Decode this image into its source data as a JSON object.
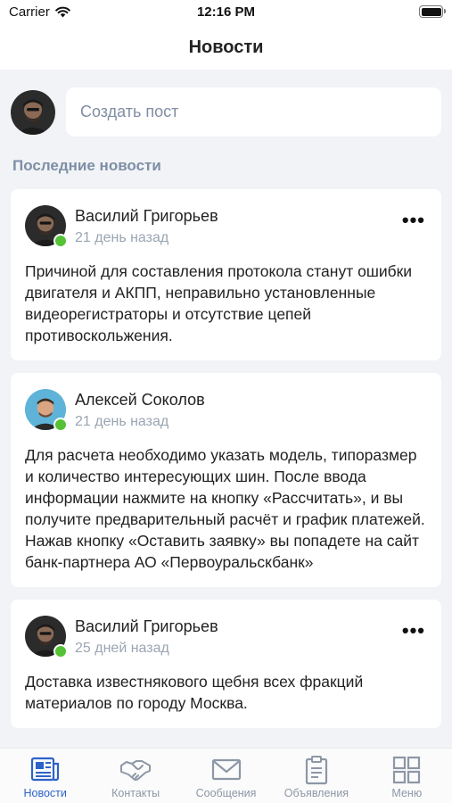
{
  "status_bar": {
    "carrier": "Carrier",
    "time": "12:16 PM"
  },
  "header": {
    "title": "Новости"
  },
  "composer": {
    "placeholder": "Создать пост"
  },
  "section": {
    "title": "Последние новости"
  },
  "posts": [
    {
      "author": "Василий Григорьев",
      "time": "21 день назад",
      "has_menu": true,
      "online": true,
      "text": "Причиной для составления протокола станут ошибки двигателя и АКПП, неправильно установленные видеорегистраторы и отсутствие цепей противоскольжения."
    },
    {
      "author": "Алексей Соколов",
      "time": "21 день назад",
      "has_menu": false,
      "online": true,
      "text": "Для расчета необходимо указать модель, типоразмер и количество интересующих шин. После ввода информации нажмите на кнопку «Рассчитать», и вы получите предварительный расчёт и график платежей. Нажав кнопку «Оставить заявку» вы попадете на сайт банк-партнера АО «Первоуральскбанк»"
    },
    {
      "author": "Василий Григорьев",
      "time": "25 дней назад",
      "has_menu": true,
      "online": true,
      "text": "Доставка известнякового щебня всех фракций материалов по городу Москва."
    }
  ],
  "tabs": [
    {
      "label": "Новости",
      "icon": "newspaper-icon",
      "active": true
    },
    {
      "label": "Контакты",
      "icon": "handshake-icon",
      "active": false
    },
    {
      "label": "Сообщения",
      "icon": "envelope-icon",
      "active": false
    },
    {
      "label": "Объявления",
      "icon": "clipboard-icon",
      "active": false
    },
    {
      "label": "Меню",
      "icon": "grid-icon",
      "active": false
    }
  ],
  "colors": {
    "accent": "#2d63c8",
    "online": "#55c236",
    "muted": "#9aa5b3",
    "background": "#f2f3f6"
  }
}
